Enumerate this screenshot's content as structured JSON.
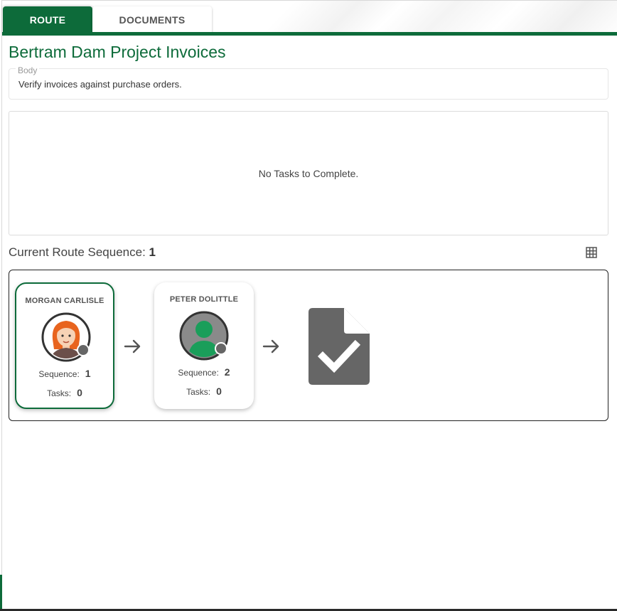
{
  "tabs": [
    {
      "label": "ROUTE",
      "active": true
    },
    {
      "label": "DOCUMENTS",
      "active": false
    }
  ],
  "page_title": "Bertram Dam Project Invoices",
  "body_field": {
    "legend": "Body",
    "value": "Verify invoices against purchase orders."
  },
  "tasks_message": "No Tasks to Complete.",
  "route_sequence": {
    "label": "Current Route Sequence:",
    "current": "1"
  },
  "route_cards": [
    {
      "name": "MORGAN CARLISLE",
      "sequence_label": "Sequence:",
      "sequence": "1",
      "tasks_label": "Tasks:",
      "tasks": "0",
      "avatar": "illustrated-avatar-redhead",
      "active": true
    },
    {
      "name": "PETER DOLITTLE",
      "sequence_label": "Sequence:",
      "sequence": "2",
      "tasks_label": "Tasks:",
      "tasks": "0",
      "avatar": "generic-user-icon-green",
      "active": false
    }
  ],
  "end_icon": "document-check-icon",
  "colors": {
    "brand_green": "#0d6b3a",
    "status_dot": "#666666",
    "doc_icon": "#666666",
    "avatar_green": "#1a9e5a"
  }
}
